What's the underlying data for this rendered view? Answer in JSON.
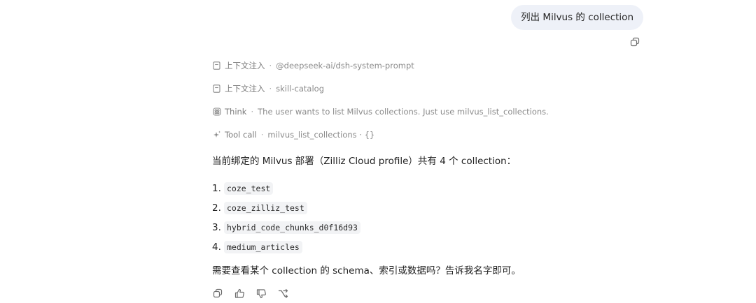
{
  "user_message": "列出 Milvus 的 collection",
  "steps": [
    {
      "icon": "file-icon",
      "label": "上下文注入",
      "detail": "@deepseek-ai/dsh-system-prompt"
    },
    {
      "icon": "file-icon",
      "label": "上下文注入",
      "detail": "skill-catalog"
    },
    {
      "icon": "think-icon",
      "label": "Think",
      "detail": "The user wants to list Milvus collections. Just use milvus_list_collections."
    },
    {
      "icon": "sparkle-icon",
      "label": "Tool call",
      "detail": "milvus_list_collections · {}"
    }
  ],
  "step_separator": "·",
  "answer": {
    "intro": "当前绑定的 Milvus 部署（Zilliz Cloud profile）共有 4 个 collection：",
    "collections": [
      {
        "num": "1.",
        "name": "coze_test"
      },
      {
        "num": "2.",
        "name": "coze_zilliz_test"
      },
      {
        "num": "3.",
        "name": "hybrid_code_chunks_d0f16d93"
      },
      {
        "num": "4.",
        "name": "medium_articles"
      }
    ],
    "outro": "需要查看某个 collection 的 schema、索引或数据吗？告诉我名字即可。"
  },
  "action_icons": [
    "copy-icon",
    "thumbs-up-icon",
    "thumbs-down-icon",
    "branch-icon"
  ]
}
